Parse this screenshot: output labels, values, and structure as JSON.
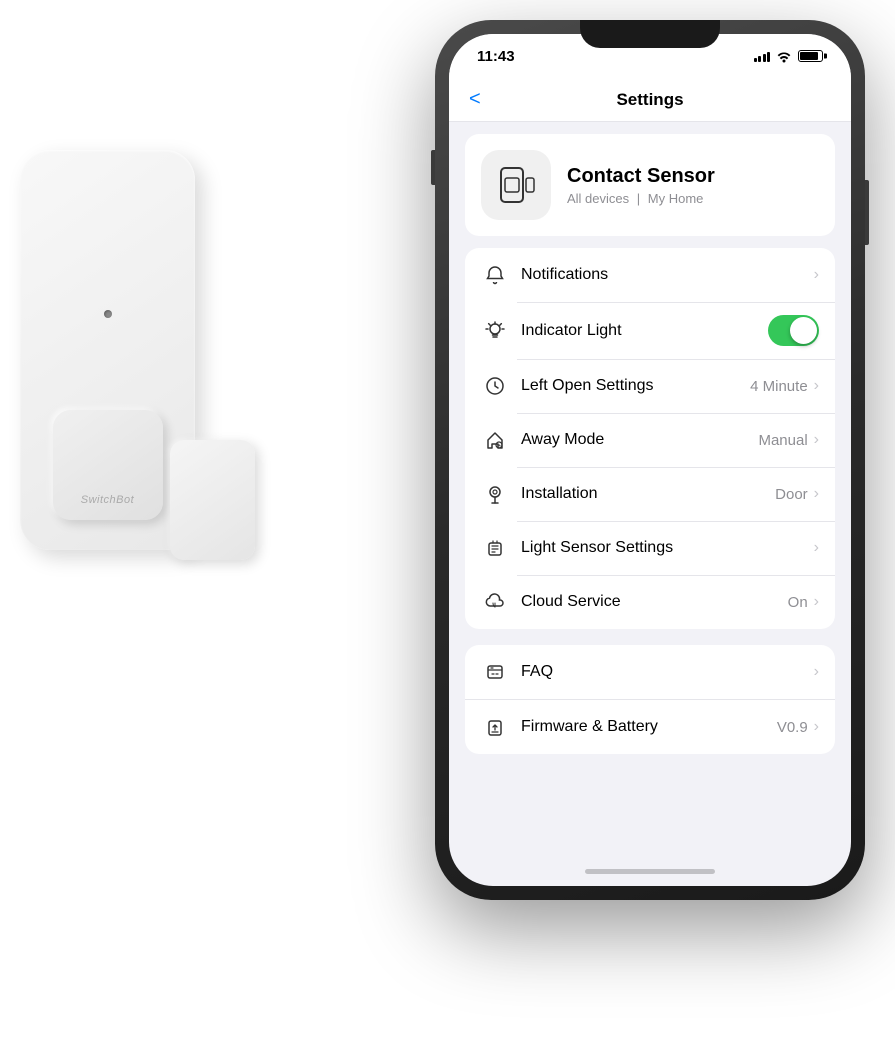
{
  "scene": {
    "background": "#ffffff"
  },
  "phone": {
    "status_bar": {
      "time": "11:43",
      "location_icon": "▲"
    },
    "nav": {
      "back_label": "<",
      "title": "Settings"
    },
    "device_header": {
      "name": "Contact Sensor",
      "breadcrumb_all": "All devices",
      "breadcrumb_sep": "|",
      "breadcrumb_home": "My Home"
    },
    "settings_section1": {
      "rows": [
        {
          "id": "notifications",
          "label": "Notifications",
          "value": "",
          "has_chevron": true,
          "has_toggle": false,
          "icon": "bell"
        },
        {
          "id": "indicator-light",
          "label": "Indicator Light",
          "value": "",
          "has_chevron": false,
          "has_toggle": true,
          "toggle_on": true,
          "icon": "bulb"
        },
        {
          "id": "left-open",
          "label": "Left Open Settings",
          "value": "4 Minute",
          "has_chevron": true,
          "has_toggle": false,
          "icon": "clock"
        },
        {
          "id": "away-mode",
          "label": "Away Mode",
          "value": "Manual",
          "has_chevron": true,
          "has_toggle": false,
          "icon": "home"
        },
        {
          "id": "installation",
          "label": "Installation",
          "value": "Door",
          "has_chevron": true,
          "has_toggle": false,
          "icon": "pin"
        },
        {
          "id": "light-sensor",
          "label": "Light Sensor Settings",
          "value": "",
          "has_chevron": true,
          "has_toggle": false,
          "icon": "sensor"
        },
        {
          "id": "cloud-service",
          "label": "Cloud Service",
          "value": "On",
          "has_chevron": true,
          "has_toggle": false,
          "icon": "cloud"
        }
      ]
    },
    "settings_section2": {
      "rows": [
        {
          "id": "faq",
          "label": "FAQ",
          "value": "",
          "has_chevron": true,
          "icon": "faq"
        },
        {
          "id": "firmware",
          "label": "Firmware & Battery",
          "value": "V0.9",
          "has_chevron": true,
          "icon": "upload"
        }
      ]
    }
  },
  "device": {
    "brand_label": "SwitchBot"
  }
}
